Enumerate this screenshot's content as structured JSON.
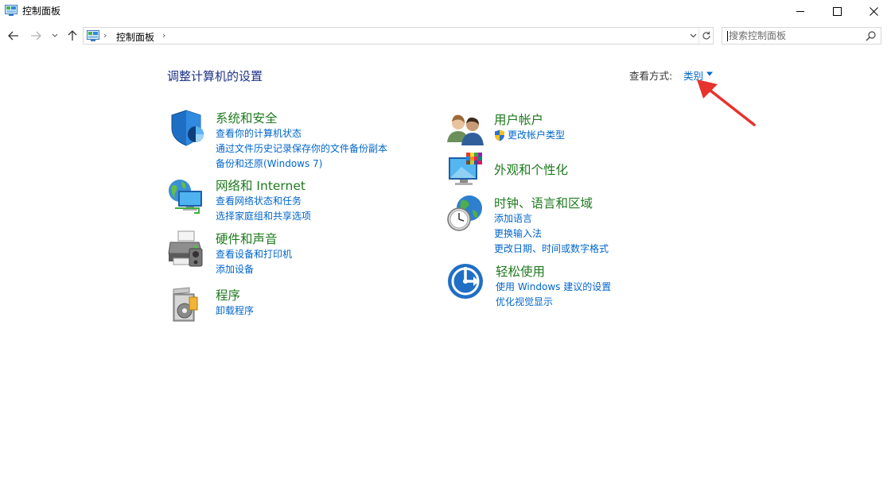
{
  "window": {
    "title": "控制面板"
  },
  "navigation": {
    "breadcrumb": "控制面板",
    "search_placeholder": "搜索控制面板"
  },
  "main": {
    "heading": "调整计算机的设置",
    "view_by_label": "查看方式:",
    "view_by_value": "类别",
    "left_categories": [
      {
        "title": "系统和安全",
        "icon": "shield-icon",
        "links": [
          "查看你的计算机状态",
          "通过文件历史记录保存你的文件备份副本",
          "备份和还原(Windows 7)"
        ]
      },
      {
        "title": "网络和 Internet",
        "icon": "network-icon",
        "links": [
          "查看网络状态和任务",
          "选择家庭组和共享选项"
        ]
      },
      {
        "title": "硬件和声音",
        "icon": "printer-icon",
        "links": [
          "查看设备和打印机",
          "添加设备"
        ]
      },
      {
        "title": "程序",
        "icon": "programs-icon",
        "links": [
          "卸载程序"
        ]
      }
    ],
    "right_categories": [
      {
        "title": "用户帐户",
        "icon": "users-icon",
        "links": [
          "更改帐户类型"
        ]
      },
      {
        "title": "外观和个性化",
        "icon": "appearance-icon",
        "links": []
      },
      {
        "title": "时钟、语言和区域",
        "icon": "clock-globe-icon",
        "links": [
          "添加语言",
          "更换输入法",
          "更改日期、时间或数字格式"
        ]
      },
      {
        "title": "轻松使用",
        "icon": "accessibility-icon",
        "links": [
          "使用 Windows 建议的设置",
          "优化视觉显示"
        ]
      }
    ]
  },
  "colors": {
    "heading": "#1e3287",
    "category_title": "#1e7a1e",
    "link": "#0066cc",
    "annotation_arrow": "#e8322c"
  }
}
